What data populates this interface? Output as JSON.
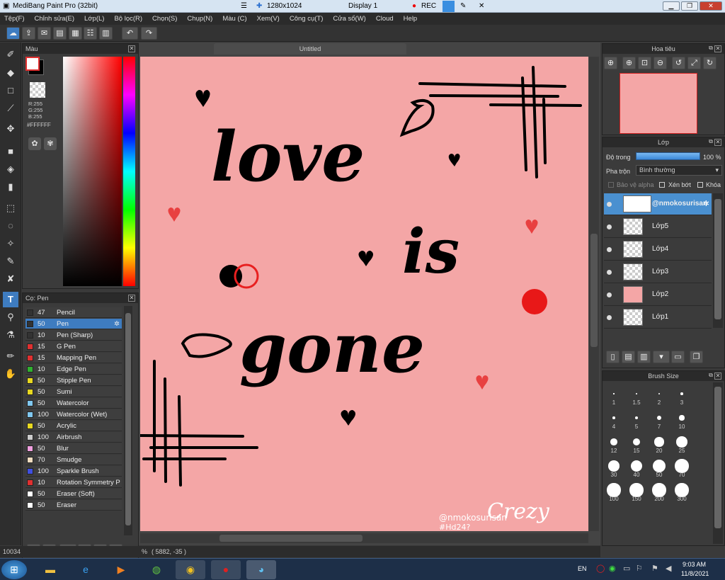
{
  "window": {
    "title": "MediBang Paint Pro (32bit)",
    "canvas_size": "1280x1024",
    "display": "Display 1",
    "rec": "REC"
  },
  "menu": [
    "Tệp(F)",
    "Chỉnh sửa(E)",
    "Lớp(L)",
    "Bộ lọc(R)",
    "Chọn(S)",
    "Chụp(N)",
    "Màu (C)",
    "Xem(V)",
    "Công cụ(T)",
    "Cửa sổ(W)",
    "Cloud",
    "Help"
  ],
  "color_panel": {
    "title": "Màu",
    "r": "R:255",
    "g": "G:255",
    "b": "B:255",
    "hex": "#FFFFFF"
  },
  "brush_panel": {
    "title": "Cọ: Pen",
    "brushes": [
      {
        "size": "47",
        "name": "Pencil",
        "color": "#333333"
      },
      {
        "size": "50",
        "name": "Pen",
        "color": "#333333",
        "selected": true
      },
      {
        "size": "10",
        "name": "Pen (Sharp)",
        "color": "#333333"
      },
      {
        "size": "15",
        "name": "G Pen",
        "color": "#e03030"
      },
      {
        "size": "15",
        "name": "Mapping Pen",
        "color": "#e03030"
      },
      {
        "size": "10",
        "name": "Edge Pen",
        "color": "#30b030"
      },
      {
        "size": "50",
        "name": "Stipple Pen",
        "color": "#e8d820"
      },
      {
        "size": "50",
        "name": "Sumi",
        "color": "#e8d820"
      },
      {
        "size": "50",
        "name": "Watercolor",
        "color": "#80c8f0"
      },
      {
        "size": "100",
        "name": "Watercolor (Wet)",
        "color": "#80c8f0"
      },
      {
        "size": "50",
        "name": "Acrylic",
        "color": "#e8d820"
      },
      {
        "size": "100",
        "name": "Airbrush",
        "color": "#cccccc"
      },
      {
        "size": "50",
        "name": "Blur",
        "color": "#f0a0e0"
      },
      {
        "size": "70",
        "name": "Smudge",
        "color": "#f0dcc0"
      },
      {
        "size": "100",
        "name": "Sparkle Brush",
        "color": "#4050e0"
      },
      {
        "size": "10",
        "name": "Rotation Symmetry P",
        "color": "#e03030"
      },
      {
        "size": "50",
        "name": "Eraser (Soft)",
        "color": "#ffffff"
      },
      {
        "size": "50",
        "name": "Eraser",
        "color": "#ffffff"
      }
    ]
  },
  "canvas": {
    "tab": "Untitled",
    "text1": "love",
    "text2": "is",
    "text3": "gone",
    "signature": "@nmokosurisan",
    "hashtag": "#Hd24?",
    "crazy": "Crezy",
    "bg": "#f4a6a6"
  },
  "status": {
    "zoom": "10034",
    "unit": "%",
    "coords": "( 5882, -35 )"
  },
  "navigator": {
    "title": "Hoa tiêu"
  },
  "layer_panel": {
    "title": "Lớp",
    "opacity_label": "Độ trong",
    "opacity_value": "100 %",
    "blend_label": "Pha trộn",
    "blend_value": "Bình thường",
    "protect_alpha": "Bảo vệ alpha",
    "clip": "Xén bớt",
    "lock": "Khóa",
    "layers": [
      {
        "name": "@nmokosurisan",
        "selected": true
      },
      {
        "name": "Lớp5"
      },
      {
        "name": "Lớp4"
      },
      {
        "name": "Lớp3"
      },
      {
        "name": "Lớp2"
      },
      {
        "name": "Lớp1"
      }
    ]
  },
  "brush_size": {
    "title": "Brush Size",
    "sizes": [
      "1",
      "1.5",
      "2",
      "3",
      "4",
      "5",
      "7",
      "10",
      "12",
      "15",
      "20",
      "25",
      "30",
      "40",
      "50",
      "70",
      "100",
      "150",
      "200",
      "300"
    ]
  },
  "taskbar": {
    "lang": "EN",
    "time": "9:03 AM",
    "date": "11/8/2021"
  }
}
